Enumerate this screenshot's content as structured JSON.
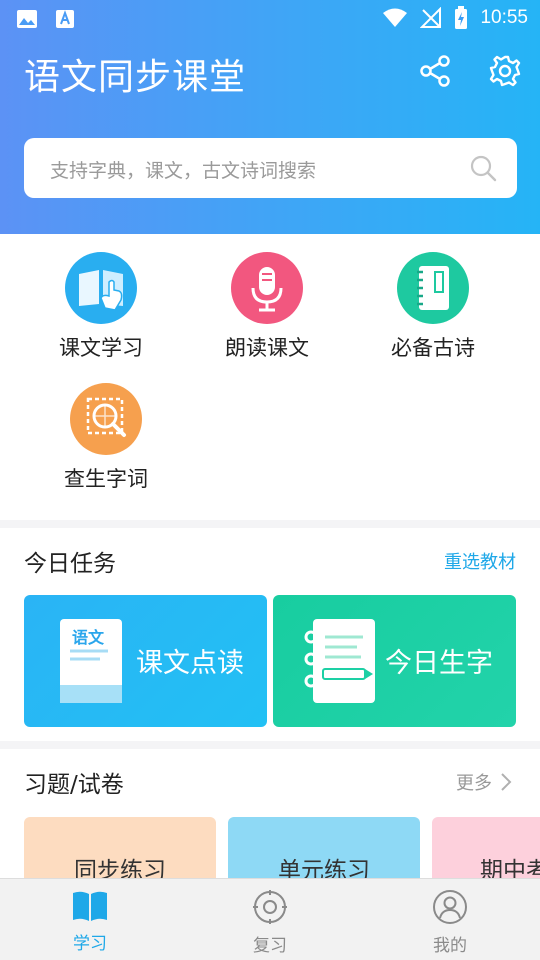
{
  "status_bar": {
    "time": "10:55"
  },
  "header": {
    "title": "语文同步课堂",
    "search_placeholder": "支持字典，课文，古文诗词搜索"
  },
  "grid": [
    {
      "label": "课文学习",
      "icon": "book-hand-icon",
      "color": "#29aef0"
    },
    {
      "label": "朗读课文",
      "icon": "microphone-icon",
      "color": "#f2577f"
    },
    {
      "label": "必备古诗",
      "icon": "notebook-icon",
      "color": "#1ec9a0"
    },
    {
      "label": "查生字词",
      "icon": "magnifier-icon",
      "color": "#f6a04e"
    }
  ],
  "tasks": {
    "title": "今日任务",
    "link": "重选教材",
    "cards": [
      {
        "label": "课文点读",
        "book_title": "语文",
        "color": "#22b8f4"
      },
      {
        "label": "今日生字",
        "color": "#1dd0a5"
      }
    ]
  },
  "exercises": {
    "title": "习题/试卷",
    "more": "更多",
    "cards": [
      {
        "label": "同步练习",
        "color": "#fddcc0"
      },
      {
        "label": "单元练习",
        "color": "#8ed9f5"
      },
      {
        "label": "期中考",
        "color": "#fdd0dc"
      }
    ]
  },
  "tab_bar": {
    "tabs": [
      {
        "label": "学习",
        "icon": "book-icon",
        "active": true
      },
      {
        "label": "复习",
        "icon": "target-icon",
        "active": false
      },
      {
        "label": "我的",
        "icon": "user-icon",
        "active": false
      }
    ],
    "active_color": "#1fa8e8",
    "inactive_color": "#8a8a8a"
  }
}
